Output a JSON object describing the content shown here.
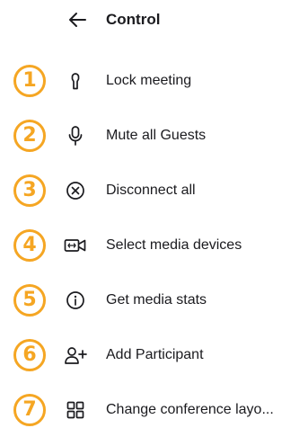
{
  "header": {
    "title": "Control",
    "back_icon": "arrow-left-icon"
  },
  "badge_color": "#f5a623",
  "items": [
    {
      "number": "1",
      "label": "Lock meeting",
      "icon": "lock-icon"
    },
    {
      "number": "2",
      "label": "Mute all Guests",
      "icon": "microphone-icon"
    },
    {
      "number": "3",
      "label": "Disconnect all",
      "icon": "close-circle-icon"
    },
    {
      "number": "4",
      "label": "Select media devices",
      "icon": "video-camera-icon"
    },
    {
      "number": "5",
      "label": "Get media stats",
      "icon": "info-icon"
    },
    {
      "number": "6",
      "label": "Add Participant",
      "icon": "add-person-icon"
    },
    {
      "number": "7",
      "label": "Change conference layo...",
      "icon": "grid-layout-icon"
    }
  ]
}
